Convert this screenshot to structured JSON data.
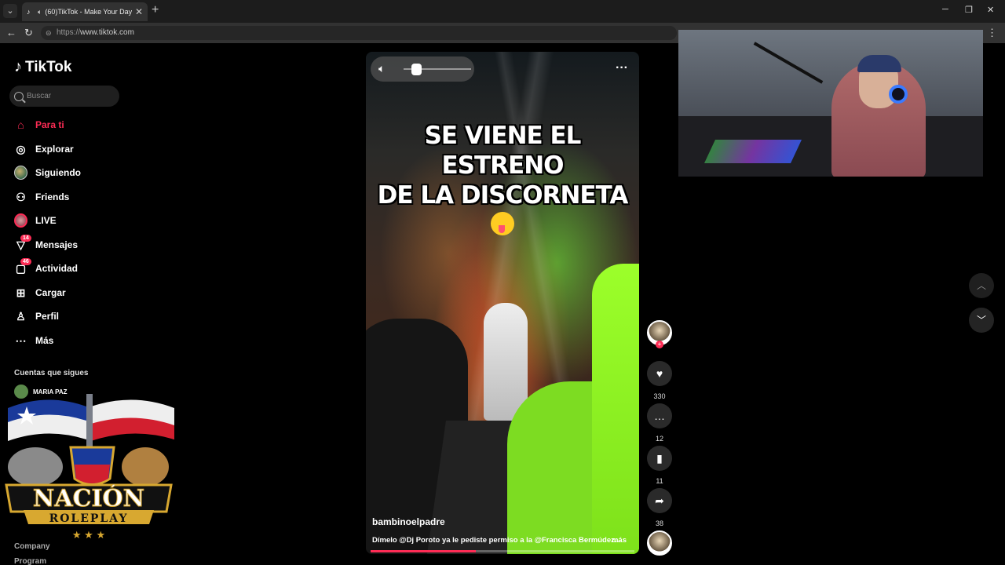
{
  "browser": {
    "tab_title": "(60)TikTok - Make Your Day",
    "url_proto": "https://",
    "url_host": "www.tiktok.com"
  },
  "brand": {
    "name": "TikTok"
  },
  "search": {
    "placeholder": "Buscar"
  },
  "sidebar": {
    "items": [
      {
        "label": "Para ti",
        "icon": "home-icon"
      },
      {
        "label": "Explorar",
        "icon": "compass-icon"
      },
      {
        "label": "Siguiendo",
        "icon": "avatar-icon"
      },
      {
        "label": "Friends",
        "icon": "friends-icon"
      },
      {
        "label": "LIVE",
        "icon": "live-icon"
      },
      {
        "label": "Mensajes",
        "icon": "message-icon",
        "badge": "14"
      },
      {
        "label": "Actividad",
        "icon": "activity-icon",
        "badge": "46"
      },
      {
        "label": "Cargar",
        "icon": "upload-icon"
      },
      {
        "label": "Perfil",
        "icon": "profile-icon"
      },
      {
        "label": "Más",
        "icon": "more-icon"
      }
    ],
    "following_heading": "Cuentas que sigues",
    "following": [
      {
        "name": "MARIA PAZ"
      }
    ],
    "footer": [
      "Company",
      "Program"
    ]
  },
  "overlay": {
    "line1": "NACIÓN",
    "line2": "ROLEPLAY"
  },
  "video": {
    "caption_line1": "SE VIENE EL ESTRENO",
    "caption_line2": "DE LA DISCORNETA",
    "author": "bambinoelpadre",
    "description": "Dímelo @Dj Poroto ya le pediste permiso a la @Francisca Bermúdez...",
    "more_label": "más",
    "volume_level": 0.15,
    "progress": 0.4
  },
  "actions": {
    "likes": "330",
    "comments": "12",
    "saves": "11",
    "shares": "38"
  },
  "colors": {
    "accent": "#fe2c55",
    "bg": "#000000"
  }
}
